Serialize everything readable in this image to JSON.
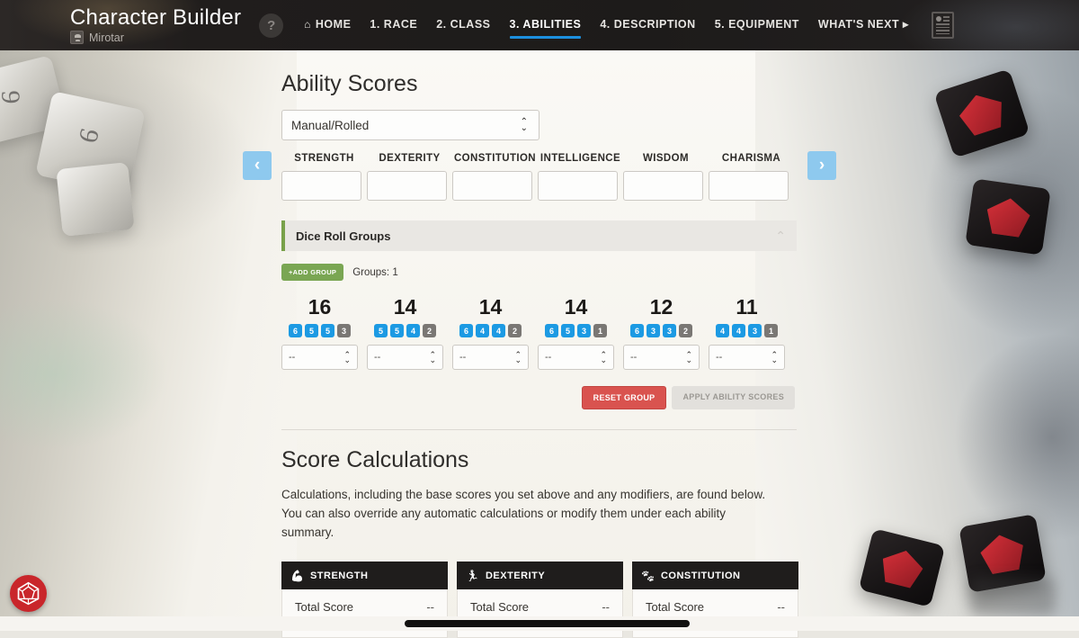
{
  "header": {
    "title": "Character Builder",
    "user": "Mirotar",
    "help_label": "?",
    "avatar_icon": "avatar-icon",
    "sheet_icon": "character-sheet-icon",
    "nav": [
      {
        "label": "HOME",
        "icon": "home-icon",
        "active": false
      },
      {
        "label": "1. RACE",
        "active": false
      },
      {
        "label": "2. CLASS",
        "active": false
      },
      {
        "label": "3. ABILITIES",
        "active": true
      },
      {
        "label": "4. DESCRIPTION",
        "active": false
      },
      {
        "label": "5. EQUIPMENT",
        "active": false
      },
      {
        "label": "WHAT'S NEXT ▸",
        "active": false
      }
    ],
    "accent_color": "#1c8fdd"
  },
  "nav_arrows": {
    "prev_icon": "chevron-left-icon",
    "prev_glyph": "‹",
    "next_icon": "chevron-right-icon",
    "next_glyph": "›",
    "color": "#8ec9ee"
  },
  "ability_scores": {
    "title": "Ability Scores",
    "method_select": {
      "value": "Manual/Rolled",
      "stepper_glyph": "⌃⌄"
    },
    "columns": [
      "STRENGTH",
      "DEXTERITY",
      "CONSTITUTION",
      "INTELLIGENCE",
      "WISDOM",
      "CHARISMA"
    ],
    "input_values": [
      "",
      "",
      "",
      "",
      "",
      ""
    ]
  },
  "dice_roll_groups": {
    "panel_title": "Dice Roll Groups",
    "collapse_icon": "chevron-up-icon",
    "collapse_glyph": "⌃",
    "add_group_label": "+ADD GROUP",
    "add_group_color": "#7aa653",
    "groups_count_label": "Groups: 1",
    "columns": [
      {
        "total": "16",
        "rolls": [
          {
            "v": "6",
            "kept": true
          },
          {
            "v": "5",
            "kept": true
          },
          {
            "v": "5",
            "kept": true
          },
          {
            "v": "3",
            "kept": false
          }
        ],
        "assign": "--"
      },
      {
        "total": "14",
        "rolls": [
          {
            "v": "5",
            "kept": true
          },
          {
            "v": "5",
            "kept": true
          },
          {
            "v": "4",
            "kept": true
          },
          {
            "v": "2",
            "kept": false
          }
        ],
        "assign": "--"
      },
      {
        "total": "14",
        "rolls": [
          {
            "v": "6",
            "kept": true
          },
          {
            "v": "4",
            "kept": true
          },
          {
            "v": "4",
            "kept": true
          },
          {
            "v": "2",
            "kept": false
          }
        ],
        "assign": "--"
      },
      {
        "total": "14",
        "rolls": [
          {
            "v": "6",
            "kept": true
          },
          {
            "v": "5",
            "kept": true
          },
          {
            "v": "3",
            "kept": true
          },
          {
            "v": "1",
            "kept": false
          }
        ],
        "assign": "--"
      },
      {
        "total": "12",
        "rolls": [
          {
            "v": "6",
            "kept": true
          },
          {
            "v": "3",
            "kept": true
          },
          {
            "v": "3",
            "kept": true
          },
          {
            "v": "2",
            "kept": false
          }
        ],
        "assign": "--"
      },
      {
        "total": "11",
        "rolls": [
          {
            "v": "4",
            "kept": true
          },
          {
            "v": "4",
            "kept": true
          },
          {
            "v": "3",
            "kept": true
          },
          {
            "v": "1",
            "kept": false
          }
        ],
        "assign": "--"
      }
    ],
    "kept_color": "#1c9ae3",
    "dropped_color": "#7a7774",
    "reset_label": "RESET GROUP",
    "reset_color": "#d9534f",
    "apply_label": "APPLY ABILITY SCORES"
  },
  "score_calculations": {
    "title": "Score Calculations",
    "description": "Calculations, including the base scores you set above and any modifiers, are found below. You can also override any automatic calculations or modify them under each ability summary.",
    "cards": [
      {
        "name": "STRENGTH",
        "icon": "flexed-arm-icon",
        "glyph": "💪",
        "row_label": "Total Score",
        "row_value": "--"
      },
      {
        "name": "DEXTERITY",
        "icon": "running-icon",
        "glyph": "🏃",
        "row_label": "Total Score",
        "row_value": "--"
      },
      {
        "name": "CONSTITUTION",
        "icon": "heart-icon",
        "glyph": "🐾",
        "row_label": "Total Score",
        "row_value": "--"
      }
    ]
  },
  "footer": {
    "logo_icon": "d20-dice-logo",
    "logo_color": "#c9262b",
    "scrollbar_icon": "horizontal-scrollbar"
  }
}
